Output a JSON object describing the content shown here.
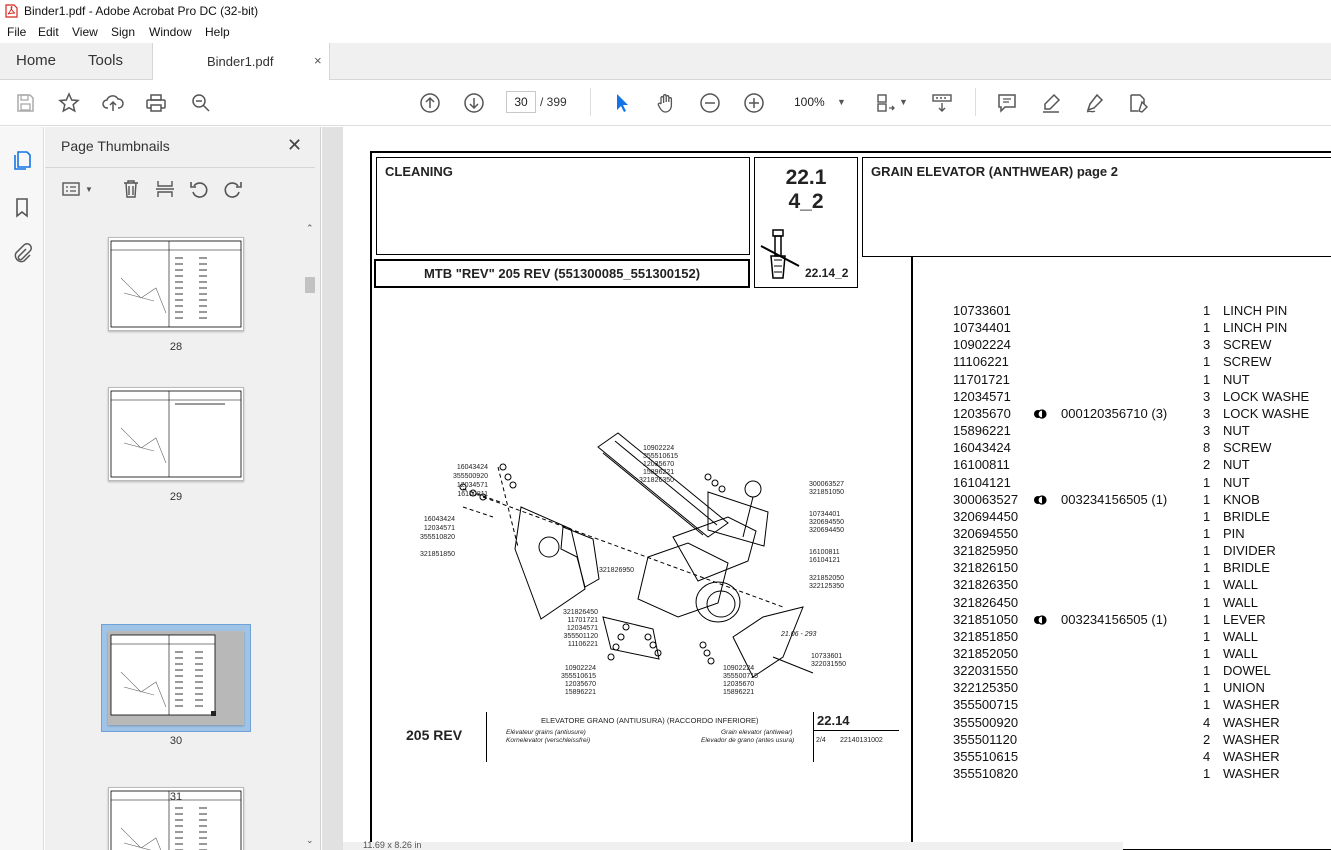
{
  "window": {
    "title": "Binder1.pdf - Adobe Acrobat Pro DC (32-bit)"
  },
  "menu": [
    "File",
    "Edit",
    "View",
    "Sign",
    "Window",
    "Help"
  ],
  "tabs": {
    "home": "Home",
    "tools": "Tools",
    "doc": "Binder1.pdf",
    "close": "×"
  },
  "toolbar": {
    "page_current": "30",
    "page_total": "/ 399",
    "zoom": "100%"
  },
  "panel": {
    "title": "Page Thumbnails",
    "close": "✕",
    "thumbs": [
      {
        "label": "28"
      },
      {
        "label": "29"
      },
      {
        "label": "30",
        "selected": true
      },
      {
        "label": "31"
      }
    ]
  },
  "document": {
    "section": "CLEANING",
    "code_main": "22.1",
    "code_sub": "4_2",
    "code_ref": "22.14_2",
    "heading": "GRAIN ELEVATOR (ANTHWEAR)  page 2",
    "model": "MTB \"REV\" 205 REV (551300085_551300152)",
    "drawing": {
      "model_label": "205 REV",
      "title_it": "ELEVATORE GRANO (ANTIUSURA) (RACCORDO INFERIORE)",
      "title_fr": "Elévateur grains (antiusure)",
      "title_de": "Kornelevator (verschleissfrei)",
      "title_en": "Grain elevator (antiwear)",
      "title_es": "Elevador de grano (antes usura)",
      "code": "22.14",
      "sheet": "2/4",
      "docnum": "22140131002",
      "date_ref": "21.06 - 293",
      "callouts_left": [
        "16043424",
        "355500920",
        "12034571",
        "16100811",
        "16043424",
        "12034571",
        "355510820",
        "321851850"
      ],
      "callouts_top": [
        "10902224",
        "355510615",
        "12035670",
        "15896221",
        "321826350"
      ],
      "callouts_right": [
        "300063527",
        "321851050",
        "10734401",
        "320694550",
        "320694450",
        "16100811",
        "16104121",
        "321852050",
        "322125350"
      ],
      "callouts_bottom": [
        "321826450",
        "11701721",
        "12034571",
        "355501120",
        "11106221",
        "10902224",
        "355510615",
        "12035670",
        "15896221",
        "10902224",
        "355500715",
        "12035670",
        "15896221",
        "10733601",
        "322031550",
        "321826950"
      ]
    },
    "parts": [
      {
        "pn": "10733601",
        "alt": "",
        "qty": "1",
        "desc": "LINCH PIN"
      },
      {
        "pn": "10734401",
        "alt": "",
        "qty": "1",
        "desc": "LINCH PIN"
      },
      {
        "pn": "10902224",
        "alt": "",
        "qty": "3",
        "desc": "SCREW"
      },
      {
        "pn": "11106221",
        "alt": "",
        "qty": "1",
        "desc": "SCREW"
      },
      {
        "pn": "11701721",
        "alt": "",
        "qty": "1",
        "desc": "NUT"
      },
      {
        "pn": "12034571",
        "alt": "",
        "qty": "3",
        "desc": "LOCK WASHE"
      },
      {
        "pn": "12035670",
        "alt": "000120356710  (3)",
        "qty": "3",
        "desc": "LOCK WASHE"
      },
      {
        "pn": "15896221",
        "alt": "",
        "qty": "3",
        "desc": "NUT"
      },
      {
        "pn": "16043424",
        "alt": "",
        "qty": "8",
        "desc": "SCREW"
      },
      {
        "pn": "16100811",
        "alt": "",
        "qty": "2",
        "desc": "NUT"
      },
      {
        "pn": "16104121",
        "alt": "",
        "qty": "1",
        "desc": "NUT"
      },
      {
        "pn": "300063527",
        "alt": "003234156505  (1)",
        "qty": "1",
        "desc": "KNOB"
      },
      {
        "pn": "320694450",
        "alt": "",
        "qty": "1",
        "desc": "BRIDLE"
      },
      {
        "pn": "320694550",
        "alt": "",
        "qty": "1",
        "desc": "PIN"
      },
      {
        "pn": "321825950",
        "alt": "",
        "qty": "1",
        "desc": "DIVIDER"
      },
      {
        "pn": "321826150",
        "alt": "",
        "qty": "1",
        "desc": "BRIDLE"
      },
      {
        "pn": "321826350",
        "alt": "",
        "qty": "1",
        "desc": "WALL"
      },
      {
        "pn": "321826450",
        "alt": "",
        "qty": "1",
        "desc": "WALL"
      },
      {
        "pn": "321851050",
        "alt": "003234156505  (1)",
        "qty": "1",
        "desc": "LEVER"
      },
      {
        "pn": "321851850",
        "alt": "",
        "qty": "1",
        "desc": "WALL"
      },
      {
        "pn": "321852050",
        "alt": "",
        "qty": "1",
        "desc": "WALL"
      },
      {
        "pn": "322031550",
        "alt": "",
        "qty": "1",
        "desc": "DOWEL"
      },
      {
        "pn": "322125350",
        "alt": "",
        "qty": "1",
        "desc": "UNION"
      },
      {
        "pn": "355500715",
        "alt": "",
        "qty": "1",
        "desc": "WASHER"
      },
      {
        "pn": "355500920",
        "alt": "",
        "qty": "4",
        "desc": "WASHER"
      },
      {
        "pn": "355501120",
        "alt": "",
        "qty": "2",
        "desc": "WASHER"
      },
      {
        "pn": "355510615",
        "alt": "",
        "qty": "4",
        "desc": "WASHER"
      },
      {
        "pn": "355510820",
        "alt": "",
        "qty": "1",
        "desc": "WASHER"
      }
    ]
  },
  "status": {
    "size": "11.69 x 8.26 in"
  }
}
